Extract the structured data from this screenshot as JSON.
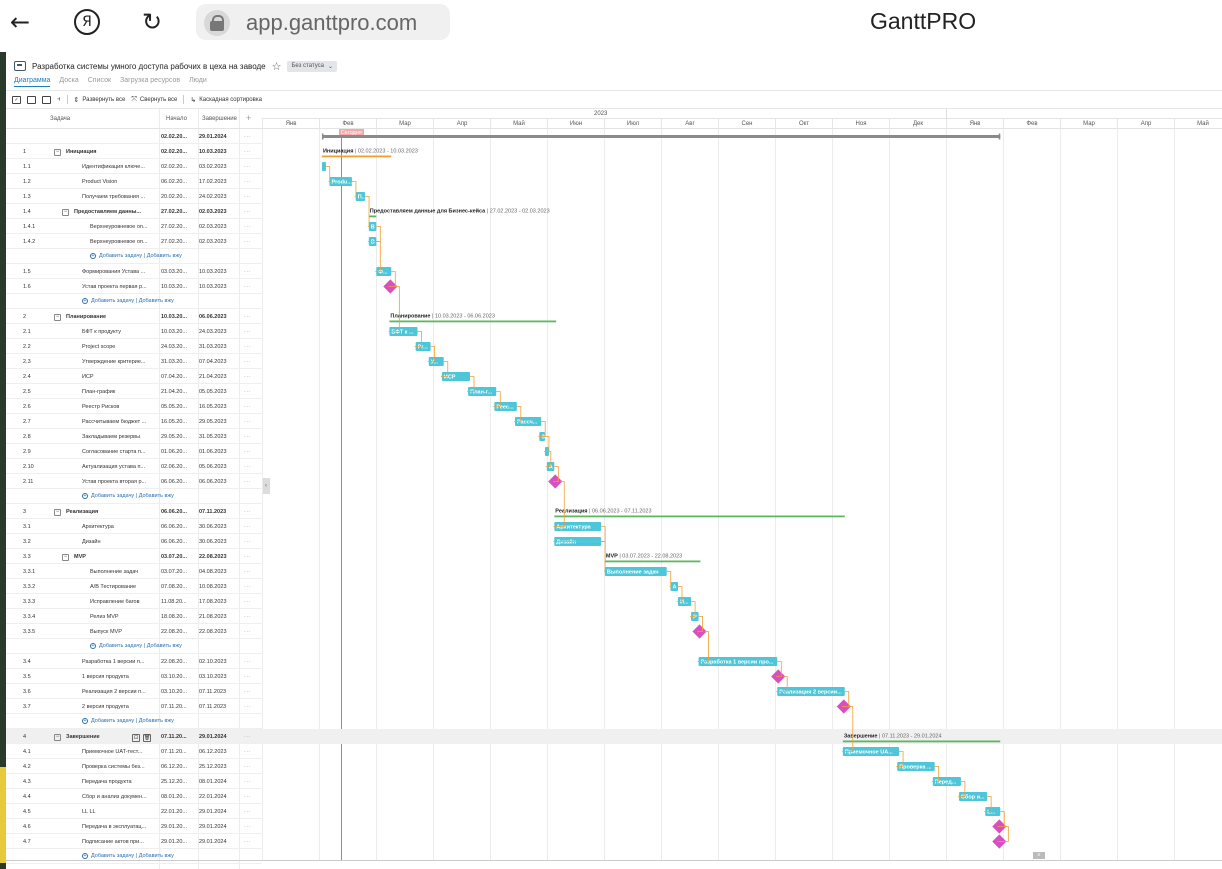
{
  "browser": {
    "url": "app.ganttpro.com",
    "brand": "GanttPRO",
    "icons": [
      "back-arrow-icon",
      "yandex-icon",
      "reload-icon",
      "lock-icon"
    ]
  },
  "project": {
    "title": "Разработка системы умного доступа рабочих в цеха на заводе",
    "status": "Без статуса"
  },
  "tabs": [
    "Диаграмма",
    "Доска",
    "Список",
    "Загрузка ресурсов",
    "Люди"
  ],
  "active_tab": 0,
  "toolbar": {
    "expand_all": "Развернуть все",
    "collapse_all": "Свернуть все",
    "cascade_sort": "Каскадная сортировка"
  },
  "grid_header": {
    "task": "Задача",
    "start": "Начало",
    "end": "Завершение",
    "add": "+"
  },
  "add_task_label": "Добавить задачу",
  "add_group_label": "Добавить вжу",
  "today_label": "Сегодня",
  "year_label": "2023",
  "months": [
    "Янв",
    "Фев",
    "Мар",
    "Апр",
    "Май",
    "Июн",
    "Июл",
    "Авг",
    "Сен",
    "Окт",
    "Ноя",
    "Дек",
    "Янв",
    "Фев",
    "Мар",
    "Апр",
    "Май"
  ],
  "rows": [
    {
      "type": "summary",
      "num": "",
      "name": "",
      "start": "02.02.20...",
      "end": "29.01.2024",
      "s": "2023-02-02",
      "e": "2024-01-29",
      "level": 0,
      "bar": "project"
    },
    {
      "type": "group",
      "num": "1",
      "name": "Инициация",
      "start": "02.02.20...",
      "end": "10.03.2023",
      "s": "2023-02-02",
      "e": "2023-03-10",
      "level": 0,
      "bar": "group",
      "color": "#f0a030",
      "label": "Инициация",
      "dates": "02.02.2023 - 10.03.2023"
    },
    {
      "type": "task",
      "num": "1.1",
      "name": "Идентификация ключе...",
      "start": "02.02.20...",
      "end": "03.02.2023",
      "s": "2023-02-02",
      "e": "2023-02-03",
      "level": 1,
      "label": ""
    },
    {
      "type": "task",
      "num": "1.2",
      "name": "Product Vision",
      "start": "06.02.20...",
      "end": "17.02.2023",
      "s": "2023-02-06",
      "e": "2023-02-17",
      "level": 1,
      "label": "Produ..."
    },
    {
      "type": "task",
      "num": "1.3",
      "name": "Получаем требования ...",
      "start": "20.02.20...",
      "end": "24.02.2023",
      "s": "2023-02-20",
      "e": "2023-02-24",
      "level": 1,
      "label": "П..."
    },
    {
      "type": "group",
      "num": "1.4",
      "name": "Предоставляем данны...",
      "start": "27.02.20...",
      "end": "02.03.2023",
      "s": "2023-02-27",
      "e": "2023-03-02",
      "level": 1,
      "bar": "group",
      "color": "#5cb85c",
      "label": "Предоставляем данные для Бизнес-кейса",
      "dates": "27.02.2023 - 02.03.2023"
    },
    {
      "type": "task",
      "num": "1.4.1",
      "name": "Верхнеуровневое оп...",
      "start": "27.02.20...",
      "end": "02.03.2023",
      "s": "2023-02-27",
      "e": "2023-03-02",
      "level": 2,
      "label": "В"
    },
    {
      "type": "task",
      "num": "1.4.2",
      "name": "Верхнеуровневое оп...",
      "start": "27.02.20...",
      "end": "02.03.2023",
      "s": "2023-02-27",
      "e": "2023-03-02",
      "level": 2,
      "label": "В"
    },
    {
      "type": "add",
      "level": 2
    },
    {
      "type": "task",
      "num": "1.5",
      "name": "Формирования Устава ...",
      "start": "03.03.20...",
      "end": "10.03.2023",
      "s": "2023-03-03",
      "e": "2023-03-10",
      "level": 1,
      "label": "Ф..."
    },
    {
      "type": "milestone",
      "num": "1.6",
      "name": "Устав проекта первая р...",
      "start": "10.03.20...",
      "end": "10.03.2023",
      "s": "2023-03-10",
      "e": "2023-03-10",
      "level": 1
    },
    {
      "type": "add",
      "level": 1
    },
    {
      "type": "group",
      "num": "2",
      "name": "Планирование",
      "start": "10.03.20...",
      "end": "06.06.2023",
      "s": "2023-03-10",
      "e": "2023-06-06",
      "level": 0,
      "bar": "group",
      "color": "#5cb85c",
      "label": "Планирование",
      "dates": "10.03.2023 - 06.06.2023"
    },
    {
      "type": "task",
      "num": "2.1",
      "name": "БФТ к продукту",
      "start": "10.03.20...",
      "end": "24.03.2023",
      "s": "2023-03-10",
      "e": "2023-03-24",
      "level": 1,
      "label": "БФТ к ..."
    },
    {
      "type": "task",
      "num": "2.2",
      "name": "Project scope",
      "start": "24.03.20...",
      "end": "31.03.2023",
      "s": "2023-03-24",
      "e": "2023-03-31",
      "level": 1,
      "label": "Pr..."
    },
    {
      "type": "task",
      "num": "2.3",
      "name": "Утверждение критерие...",
      "start": "31.03.20...",
      "end": "07.04.2023",
      "s": "2023-03-31",
      "e": "2023-04-07",
      "level": 1,
      "label": "У..."
    },
    {
      "type": "task",
      "num": "2.4",
      "name": "ИСР",
      "start": "07.04.20...",
      "end": "21.04.2023",
      "s": "2023-04-07",
      "e": "2023-04-21",
      "level": 1,
      "label": "ИСР"
    },
    {
      "type": "task",
      "num": "2.5",
      "name": "План-график",
      "start": "21.04.20...",
      "end": "05.05.2023",
      "s": "2023-04-21",
      "e": "2023-05-05",
      "level": 1,
      "label": "План-г..."
    },
    {
      "type": "task",
      "num": "2.6",
      "name": "Реестр Рисков",
      "start": "05.05.20...",
      "end": "16.05.2023",
      "s": "2023-05-05",
      "e": "2023-05-16",
      "level": 1,
      "label": "Реес..."
    },
    {
      "type": "task",
      "num": "2.7",
      "name": "Рассчитываем бюджет ...",
      "start": "16.05.20...",
      "end": "29.05.2023",
      "s": "2023-05-16",
      "e": "2023-05-29",
      "level": 1,
      "label": "Рассч..."
    },
    {
      "type": "task",
      "num": "2.8",
      "name": "Закладываем резервы",
      "start": "29.05.20...",
      "end": "31.05.2023",
      "s": "2023-05-29",
      "e": "2023-05-31",
      "level": 1,
      "label": "З"
    },
    {
      "type": "task",
      "num": "2.9",
      "name": "Согласование старта п...",
      "start": "01.06.20...",
      "end": "01.06.2023",
      "s": "2023-06-01",
      "e": "2023-06-01",
      "level": 1,
      "label": ""
    },
    {
      "type": "task",
      "num": "2.10",
      "name": "Актуализация устава п...",
      "start": "02.06.20...",
      "end": "05.06.2023",
      "s": "2023-06-02",
      "e": "2023-06-05",
      "level": 1,
      "label": "А"
    },
    {
      "type": "milestone",
      "num": "2.11",
      "name": "Устав проекта вторая р...",
      "start": "06.06.20...",
      "end": "06.06.2023",
      "s": "2023-06-06",
      "e": "2023-06-06",
      "level": 1
    },
    {
      "type": "add",
      "level": 1
    },
    {
      "type": "group",
      "num": "3",
      "name": "Реализация",
      "start": "06.06.20...",
      "end": "07.11.2023",
      "s": "2023-06-06",
      "e": "2023-11-07",
      "level": 0,
      "bar": "group",
      "color": "#5cb85c",
      "label": "Реализация",
      "dates": "06.06.2023 - 07.11.2023"
    },
    {
      "type": "task",
      "num": "3.1",
      "name": "Архитектура",
      "start": "06.06.20...",
      "end": "30.06.2023",
      "s": "2023-06-06",
      "e": "2023-06-30",
      "level": 1,
      "label": "Архитектура"
    },
    {
      "type": "task",
      "num": "3.2",
      "name": "Дизайн",
      "start": "06.06.20...",
      "end": "30.06.2023",
      "s": "2023-06-06",
      "e": "2023-06-30",
      "level": 1,
      "label": "Дизайн"
    },
    {
      "type": "group",
      "num": "3.3",
      "name": "MVP",
      "start": "03.07.20...",
      "end": "22.08.2023",
      "s": "2023-07-03",
      "e": "2023-08-22",
      "level": 1,
      "bar": "group",
      "color": "#5cb85c",
      "label": "MVP",
      "dates": "03.07.2023 - 22.08.2023"
    },
    {
      "type": "task",
      "num": "3.3.1",
      "name": "Выполнение задач",
      "start": "03.07.20...",
      "end": "04.08.2023",
      "s": "2023-07-03",
      "e": "2023-08-04",
      "level": 2,
      "label": "Выполнение задач"
    },
    {
      "type": "task",
      "num": "3.3.2",
      "name": "A/B Тестирование",
      "start": "07.08.20...",
      "end": "10.08.2023",
      "s": "2023-08-07",
      "e": "2023-08-10",
      "level": 2,
      "label": "A"
    },
    {
      "type": "task",
      "num": "3.3.3",
      "name": "Исправление багов",
      "start": "11.08.20...",
      "end": "17.08.2023",
      "s": "2023-08-11",
      "e": "2023-08-17",
      "level": 2,
      "label": "И..."
    },
    {
      "type": "task",
      "num": "3.3.4",
      "name": "Релиз MVP",
      "start": "18.08.20...",
      "end": "21.08.2023",
      "s": "2023-08-18",
      "e": "2023-08-21",
      "level": 2,
      "label": "Р"
    },
    {
      "type": "milestone",
      "num": "3.3.5",
      "name": "Выпуск MVP",
      "start": "22.08.20...",
      "end": "22.08.2023",
      "s": "2023-08-22",
      "e": "2023-08-22",
      "level": 2
    },
    {
      "type": "add",
      "level": 2
    },
    {
      "type": "task",
      "num": "3.4",
      "name": "Разработка 1 версии п...",
      "start": "22.08.20...",
      "end": "02.10.2023",
      "s": "2023-08-22",
      "e": "2023-10-02",
      "level": 1,
      "label": "Разработка 1 версии про..."
    },
    {
      "type": "milestone",
      "num": "3.5",
      "name": "1 версия продукта",
      "start": "03.10.20...",
      "end": "03.10.2023",
      "s": "2023-10-03",
      "e": "2023-10-03",
      "level": 1
    },
    {
      "type": "task",
      "num": "3.6",
      "name": "Реализация 2 версии п...",
      "start": "03.10.20...",
      "end": "07.11.2023",
      "s": "2023-10-03",
      "e": "2023-11-07",
      "level": 1,
      "label": "Реализация 2 версии..."
    },
    {
      "type": "milestone",
      "num": "3.7",
      "name": "2 версия продукта",
      "start": "07.11.20...",
      "end": "07.11.2023",
      "s": "2023-11-07",
      "e": "2023-11-07",
      "level": 1
    },
    {
      "type": "add",
      "level": 1
    },
    {
      "type": "group",
      "num": "4",
      "name": "Завершение",
      "start": "07.11.20...",
      "end": "29.01.2024",
      "s": "2023-11-07",
      "e": "2024-01-29",
      "level": 0,
      "bar": "group",
      "color": "#5cb85c",
      "label": "Завершение",
      "dates": "07.11.2023 - 29.01.2024",
      "highlight": true
    },
    {
      "type": "task",
      "num": "4.1",
      "name": "Приемочное UAT-тест...",
      "start": "07.11.20...",
      "end": "06.12.2023",
      "s": "2023-11-07",
      "e": "2023-12-06",
      "level": 1,
      "label": "Приемочное UA..."
    },
    {
      "type": "task",
      "num": "4.2",
      "name": "Проверка системы без...",
      "start": "06.12.20...",
      "end": "25.12.2023",
      "s": "2023-12-06",
      "e": "2023-12-25",
      "level": 1,
      "label": "Проверка ..."
    },
    {
      "type": "task",
      "num": "4.3",
      "name": "Передача продукта",
      "start": "25.12.20...",
      "end": "08.01.2024",
      "s": "2023-12-25",
      "e": "2024-01-08",
      "level": 1,
      "label": "Перед..."
    },
    {
      "type": "task",
      "num": "4.4",
      "name": "Сбор и анализ докумен...",
      "start": "08.01.20...",
      "end": "22.01.2024",
      "s": "2024-01-08",
      "e": "2024-01-22",
      "level": 1,
      "label": "Сбор и..."
    },
    {
      "type": "task",
      "num": "4.5",
      "name": "LL LL",
      "start": "22.01.20...",
      "end": "29.01.2024",
      "s": "2024-01-22",
      "e": "2024-01-29",
      "level": 1,
      "label": "L..."
    },
    {
      "type": "milestone",
      "num": "4.6",
      "name": "Передача в эксплуатац...",
      "start": "29.01.20...",
      "end": "29.01.2024",
      "s": "2024-01-29",
      "e": "2024-01-29",
      "level": 1
    },
    {
      "type": "milestone",
      "num": "4.7",
      "name": "Подписание актов при...",
      "start": "29.01.20...",
      "end": "29.01.2024",
      "s": "2024-01-29",
      "e": "2024-01-29",
      "level": 1
    },
    {
      "type": "add",
      "level": 1
    }
  ],
  "today": "2023-02-12",
  "colors": {
    "task": "#4cc6d8",
    "milestone": "#d94fc1",
    "link": "#f0a030",
    "today": "#e85c5c",
    "project_bar": "#8a8a8a",
    "accent": "#1a7fc4"
  }
}
